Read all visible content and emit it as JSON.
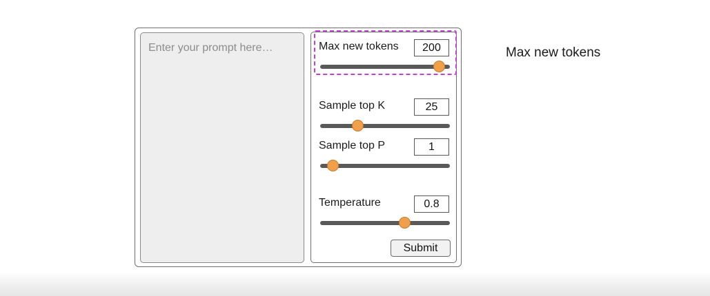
{
  "prompt": {
    "placeholder": "Enter your prompt here…"
  },
  "params": {
    "max_new_tokens": {
      "label": "Max new tokens",
      "value": "200",
      "slider_fraction": 0.92
    },
    "top_k": {
      "label": "Sample top K",
      "value": "25",
      "slider_fraction": 0.29
    },
    "top_p": {
      "label": "Sample top P",
      "value": "1",
      "slider_fraction": 0.1
    },
    "temperature": {
      "label": "Temperature",
      "value": "0.8",
      "slider_fraction": 0.65
    }
  },
  "submit_label": "Submit",
  "side_caption": "Max new tokens",
  "colors": {
    "knob": "#f0a04b",
    "highlight": "#c23fd3",
    "track": "#595959"
  }
}
